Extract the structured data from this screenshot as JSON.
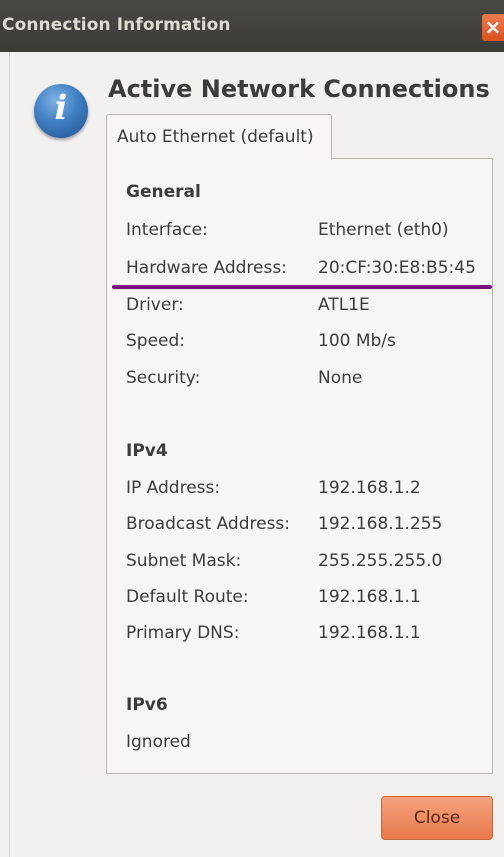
{
  "window": {
    "title": "Connection Information",
    "close_glyph": "×"
  },
  "heading": "Active Network Connections",
  "tab": {
    "label": "Auto Ethernet (default)"
  },
  "general": {
    "title": "General",
    "rows": [
      {
        "label": "Interface:",
        "value": "Ethernet (eth0)"
      },
      {
        "label": "Hardware Address:",
        "value": "20:CF:30:E8:B5:45"
      },
      {
        "label": "Driver:",
        "value": "ATL1E"
      },
      {
        "label": "Speed:",
        "value": "100 Mb/s"
      },
      {
        "label": "Security:",
        "value": "None"
      }
    ]
  },
  "ipv4": {
    "title": "IPv4",
    "rows": [
      {
        "label": "IP Address:",
        "value": "192.168.1.2"
      },
      {
        "label": "Broadcast Address:",
        "value": "192.168.1.255"
      },
      {
        "label": "Subnet Mask:",
        "value": "255.255.255.0"
      },
      {
        "label": "Default Route:",
        "value": "192.168.1.1"
      },
      {
        "label": "Primary DNS:",
        "value": "192.168.1.1"
      }
    ]
  },
  "ipv6": {
    "title": "IPv6",
    "status": "Ignored"
  },
  "buttons": {
    "close_label": "Close"
  },
  "colors": {
    "annotation_underline": "#7a0f7e",
    "close_button": "#e8794c",
    "title_bar": "#3b3a36",
    "info_icon": "#3f7fc2"
  },
  "icons": {
    "info": "information-icon",
    "window_close": "close-icon"
  }
}
